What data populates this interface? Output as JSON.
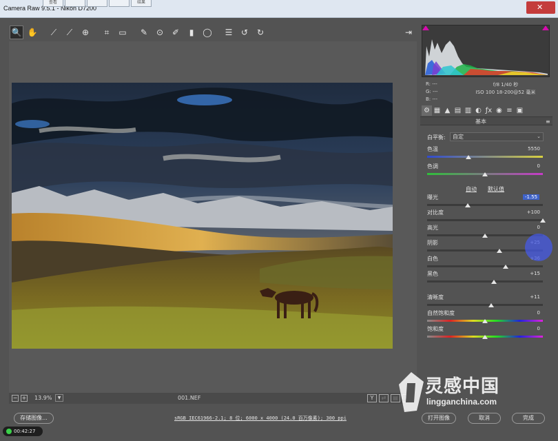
{
  "window": {
    "title": "Camera Raw 9.5.1 -  Nikon D7200",
    "tab_strip": [
      "查看",
      "",
      "",
      "",
      "结果"
    ]
  },
  "toolbar": {
    "tools": [
      {
        "name": "zoom-tool",
        "glyph": "🔍",
        "active": true
      },
      {
        "name": "hand-tool",
        "glyph": "✋",
        "active": false
      },
      {
        "name": "white-balance-tool",
        "glyph": "⟋",
        "active": false
      },
      {
        "name": "color-sampler-tool",
        "glyph": "⟋",
        "active": false
      },
      {
        "name": "targeted-adjustment-tool",
        "glyph": "⊕",
        "active": false
      },
      {
        "name": "crop-tool",
        "glyph": "⌗",
        "active": false
      },
      {
        "name": "straighten-tool",
        "glyph": "▭",
        "active": false
      },
      {
        "name": "spot-removal-tool",
        "glyph": "✎",
        "active": false
      },
      {
        "name": "red-eye-tool",
        "glyph": "⊙",
        "active": false
      },
      {
        "name": "adjustment-brush-tool",
        "glyph": "✐",
        "active": false
      },
      {
        "name": "graduated-filter-tool",
        "glyph": "▮",
        "active": false
      },
      {
        "name": "radial-filter-tool",
        "glyph": "◯",
        "active": false
      },
      {
        "name": "preferences-tool",
        "glyph": "☰",
        "active": false
      },
      {
        "name": "rotate-left-tool",
        "glyph": "↺",
        "active": false
      },
      {
        "name": "rotate-right-tool",
        "glyph": "↻",
        "active": false
      }
    ]
  },
  "preview": {
    "zoom_value": "13.9%",
    "filename": "001.NEF",
    "view_label": "Y"
  },
  "readout": {
    "r": "R:  ---",
    "g": "G:  ---",
    "b": "B:  ---",
    "exif_line1": "f/8   1/40 秒",
    "exif_line2": "ISO 100   18-200@52 毫米"
  },
  "panel": {
    "title": "基本",
    "tabs": [
      "⚙",
      "▦",
      "▲",
      "▤",
      "▥",
      "◐",
      "ƒx",
      "◉",
      "≡",
      "▣"
    ],
    "white_balance_label": "白平衡:",
    "white_balance_value": "自定",
    "auto_label": "自动",
    "default_label": "默认值",
    "sliders": [
      {
        "key": "temp",
        "label": "色温",
        "value": "5550",
        "position": 0.36,
        "selected": false,
        "gradient": "temp"
      },
      {
        "key": "tint",
        "label": "色调",
        "value": "0",
        "position": 0.5,
        "selected": false,
        "gradient": "tint"
      },
      {
        "key": "exposure",
        "label": "曝光",
        "value": "-1.55",
        "position": 0.35,
        "selected": true,
        "gradient": "none"
      },
      {
        "key": "contrast",
        "label": "对比度",
        "value": "+100",
        "position": 1.0,
        "selected": false,
        "gradient": "none"
      },
      {
        "key": "highlights",
        "label": "高光",
        "value": "0",
        "position": 0.5,
        "selected": false,
        "gradient": "none"
      },
      {
        "key": "shadows",
        "label": "阴影",
        "value": "+25",
        "position": 0.625,
        "selected": false,
        "gradient": "none"
      },
      {
        "key": "whites",
        "label": "白色",
        "value": "+36",
        "position": 0.68,
        "selected": false,
        "gradient": "none"
      },
      {
        "key": "blacks",
        "label": "黑色",
        "value": "+15",
        "position": 0.575,
        "selected": false,
        "gradient": "none"
      },
      {
        "key": "clarity",
        "label": "清晰度",
        "value": "+11",
        "position": 0.555,
        "selected": false,
        "gradient": "none"
      },
      {
        "key": "vibrance",
        "label": "自然饱和度",
        "value": "0",
        "position": 0.5,
        "selected": false,
        "gradient": "sat"
      },
      {
        "key": "saturation",
        "label": "饱和度",
        "value": "0",
        "position": 0.5,
        "selected": false,
        "gradient": "sat"
      }
    ]
  },
  "bottom": {
    "save_label": "存储图像...",
    "workflow_text": "sRGB IEC61966-2.1; 8 位; 6000 x 4000 (24.0 百万像素); 300 ppi",
    "open_label": "打开图像",
    "cancel_label": "取消",
    "done_label": "完成",
    "timer": "00:42:27"
  },
  "watermark": {
    "text": "灵感中国",
    "sub": "lingganchina.com"
  },
  "colors": {
    "panel_bg": "#535353",
    "selection": "#3e62c8",
    "clip_warning": "#d60cae"
  }
}
